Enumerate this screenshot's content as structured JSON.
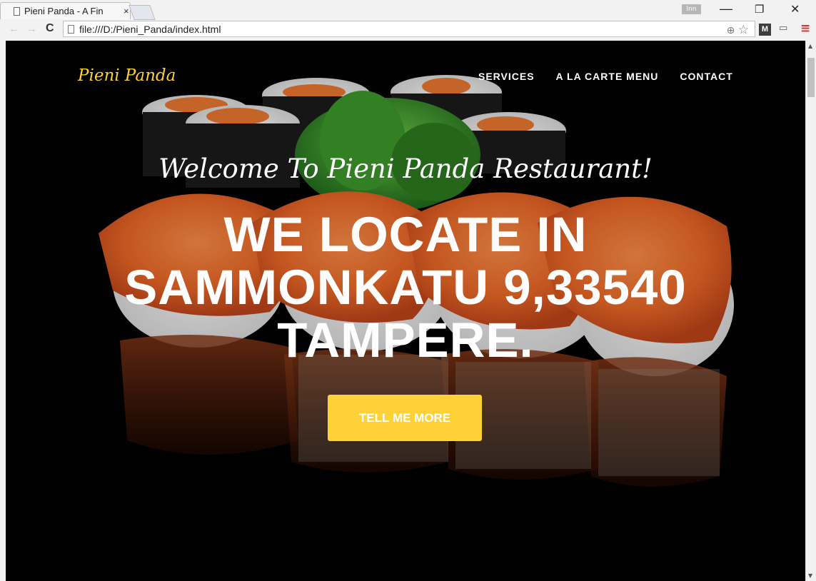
{
  "browser": {
    "tab_title": "Pieni Panda - A Fin",
    "tab_close": "×",
    "profile_label": "lnn",
    "url": "file:///D:/Pieni_Panda/index.html",
    "window_controls": {
      "minimize": "—",
      "restore": "❐",
      "close": "✕"
    },
    "back_icon": "←",
    "forward_icon": "→",
    "reload_icon": "C",
    "zoom_icon": "⊕",
    "star_icon": "☆",
    "extension_m": "M",
    "cast_icon": "▭",
    "menu_icon": "≡"
  },
  "page": {
    "brand": "Pieni Panda",
    "nav": {
      "services": "SERVICES",
      "menu": "A LA CARTE MENU",
      "contact": "CONTACT"
    },
    "welcome": "Welcome To Pieni Panda Restaurant!",
    "headline": "WE LOCATE IN SAMMONKATU 9,33540 TAMPERE.",
    "cta_label": "TELL ME MORE"
  },
  "colors": {
    "accent": "#fed136",
    "background": "#000000",
    "text": "#ffffff"
  }
}
